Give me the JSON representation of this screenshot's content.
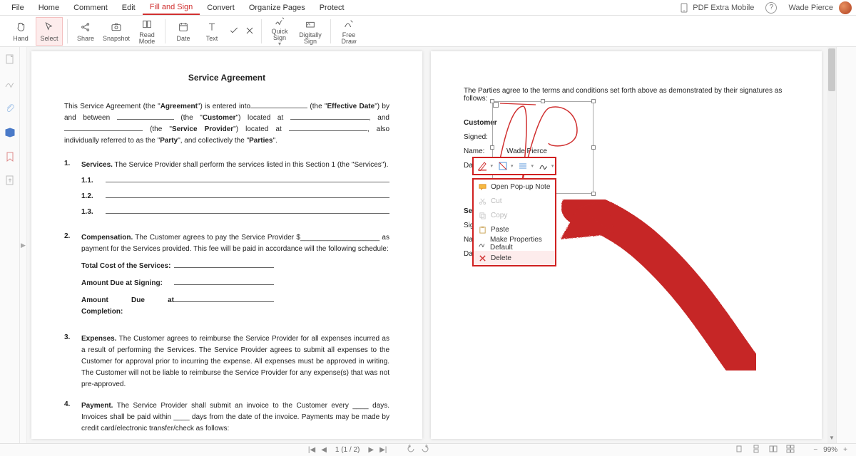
{
  "menu": [
    "File",
    "Home",
    "Comment",
    "Edit",
    "Fill and Sign",
    "Convert",
    "Organize Pages",
    "Protect"
  ],
  "menu_active_index": 4,
  "header_right": {
    "mobile": "PDF Extra Mobile",
    "username": "Wade Pierce"
  },
  "ribbon": {
    "hand": "Hand",
    "select": "Select",
    "share": "Share",
    "snapshot": "Snapshot",
    "readmode": "Read\nMode",
    "date": "Date",
    "text": "Text",
    "quicksign": "Quick\nSign",
    "digsign": "Digitally\nSign",
    "freedraw": "Free\nDraw"
  },
  "doc": {
    "title": "Service Agreement",
    "intro_parts": [
      "This Service Agreement (the \"",
      "Agreement",
      "\") is entered into",
      " (the \"",
      "Effective Date",
      "\") by and between ",
      " (the \"",
      "Customer",
      "\") located at ",
      ", and ",
      " (the \"",
      "Service Provider",
      "\") located at ",
      ", also individually referred to as the \"",
      "Party",
      "\", and collectively the \"",
      "Parties",
      "\"."
    ],
    "sections": [
      {
        "num": "1.",
        "label": "Services.",
        "text": " The Service Provider shall perform the services listed in this Section 1 (the \"Services\")."
      },
      {
        "num": "2.",
        "label": "Compensation.",
        "text": " The Customer agrees to pay the Service Provider $____________________ as payment for the Services provided. This fee will be paid in accordance will the following schedule:"
      },
      {
        "num": "3.",
        "label": "Expenses.",
        "text": " The Customer agrees to reimburse the Service Provider for all expenses incurred as a result of performing the Services. The Service Provider agrees to submit all expenses to the Customer for approval prior to incurring the expense. All expenses must be approved in writing. The Customer will not be liable to reimburse the Service Provider for any expense(s) that was not pre-approved."
      },
      {
        "num": "4.",
        "label": "Payment.",
        "text": " The Service Provider shall submit an invoice to the Customer every ____ days. Invoices shall be paid within ____ days from the date of the invoice. Payments may be made by credit card/electronic transfer/check as follows:"
      }
    ],
    "sub": [
      "1.1.",
      "1.2.",
      "1.3."
    ],
    "comp_fields": [
      "Total Cost of the Services:",
      "Amount Due at Signing:",
      "Amount Due at Completion:"
    ]
  },
  "page2": {
    "top_text": "The Parties agree to the terms and conditions set forth above as demonstrated by their signatures as follows:",
    "customer": "Customer",
    "rows": [
      "Signed:",
      "Name:",
      "Date:"
    ],
    "name_value": "Wade Pierce",
    "provider": "Ser",
    "prows": [
      "Sig",
      "Nam",
      "Dat"
    ]
  },
  "context_menu": [
    {
      "label": "Open Pop-up Note",
      "disabled": false,
      "hl": false,
      "icon": "note"
    },
    {
      "label": "Cut",
      "disabled": true,
      "hl": false,
      "icon": "cut"
    },
    {
      "label": "Copy",
      "disabled": true,
      "hl": false,
      "icon": "copy"
    },
    {
      "label": "Paste",
      "disabled": false,
      "hl": false,
      "icon": "paste"
    },
    {
      "label": "Make Properties Default",
      "disabled": false,
      "hl": false,
      "icon": "props"
    },
    {
      "label": "Delete",
      "disabled": false,
      "hl": true,
      "icon": "delete"
    }
  ],
  "status": {
    "page_display": "1 (1 / 2)",
    "zoom": "99%"
  },
  "colors": {
    "accent": "#d03030"
  }
}
